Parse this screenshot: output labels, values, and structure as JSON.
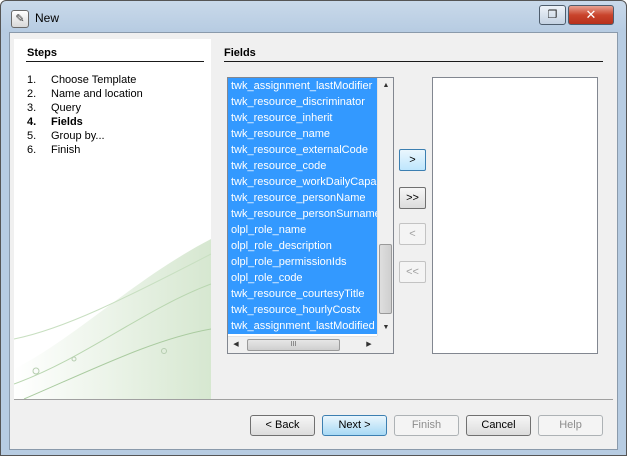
{
  "window": {
    "title": "New",
    "icon": "wizard-icon",
    "restore_glyph": "❐",
    "close_glyph": "✕"
  },
  "steps": {
    "title": "Steps",
    "items": [
      {
        "num": "1.",
        "label": "Choose Template"
      },
      {
        "num": "2.",
        "label": "Name and location"
      },
      {
        "num": "3.",
        "label": "Query"
      },
      {
        "num": "4.",
        "label": "Fields",
        "current": true
      },
      {
        "num": "5.",
        "label": "Group by..."
      },
      {
        "num": "6.",
        "label": "Finish"
      }
    ]
  },
  "fields": {
    "title": "Fields",
    "available": [
      "twk_assignment_lastModifier",
      "twk_resource_discriminator",
      "twk_resource_inherit",
      "twk_resource_name",
      "twk_resource_externalCode",
      "twk_resource_code",
      "twk_resource_workDailyCapac",
      "twk_resource_personName",
      "twk_resource_personSurname",
      "olpl_role_name",
      "olpl_role_description",
      "olpl_role_permissionIds",
      "olpl_role_code",
      "twk_resource_courtesyTitle",
      "twk_resource_hourlyCostx",
      "twk_assignment_lastModified"
    ],
    "selected": [],
    "scroll_glyphs": {
      "up": "▲",
      "down": "▼",
      "left": "◀",
      "right": "▶",
      "grip": "III"
    },
    "add_label": ">",
    "add_all_label": ">>",
    "remove_label": "<",
    "remove_all_label": "<<"
  },
  "buttons": {
    "back": "< Back",
    "next": "Next >",
    "finish": "Finish",
    "cancel": "Cancel",
    "help": "Help"
  }
}
